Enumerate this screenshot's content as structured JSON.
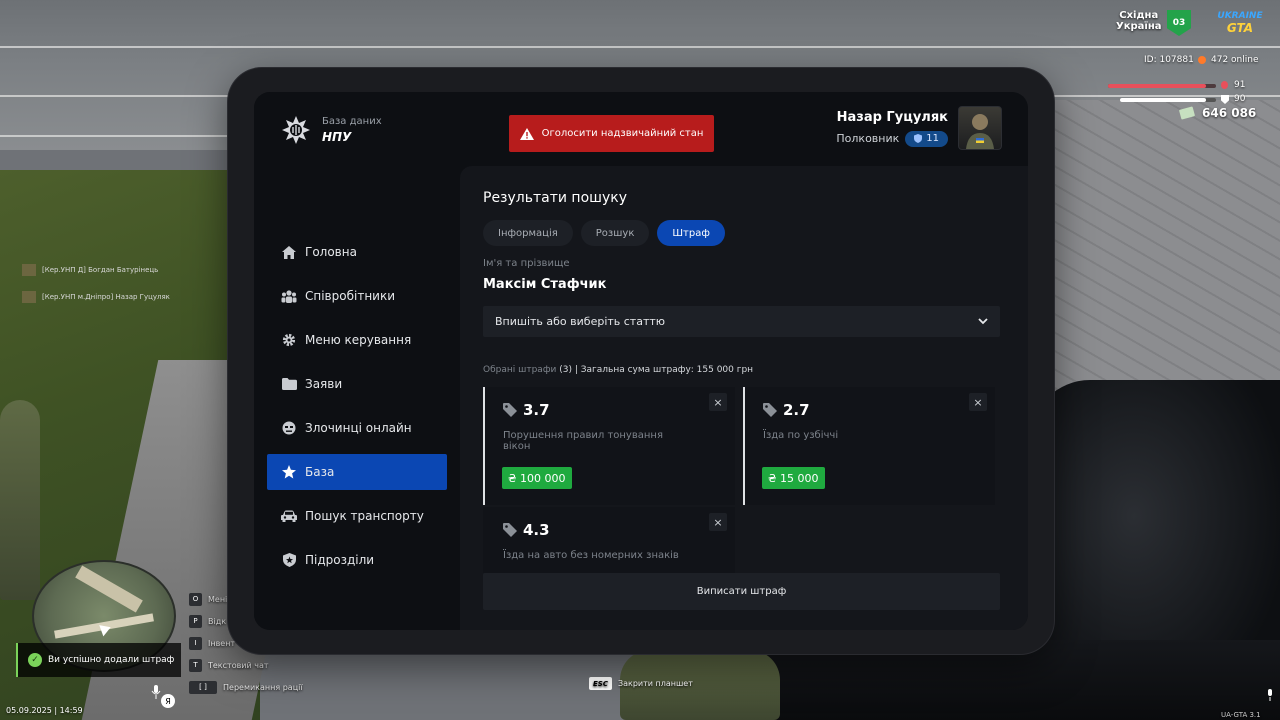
{
  "app": {
    "logo_sub": "База даних",
    "logo_main": "НПУ",
    "emergency_label": "Оголосити надзвичайний стан"
  },
  "user": {
    "name": "Назар Гуцуляк",
    "rank": "Полковник",
    "rank_level": "11"
  },
  "sidebar": {
    "items": [
      {
        "label": "Головна",
        "icon": "home-icon"
      },
      {
        "label": "Співробітники",
        "icon": "users-icon"
      },
      {
        "label": "Меню керування",
        "icon": "gear-icon"
      },
      {
        "label": "Заяви",
        "icon": "folder-icon"
      },
      {
        "label": "Злочинці онлайн",
        "icon": "criminal-icon"
      },
      {
        "label": "База",
        "icon": "star-icon",
        "active": true
      },
      {
        "label": "Пошук транспорту",
        "icon": "car-icon"
      },
      {
        "label": "Підрозділи",
        "icon": "shield-icon"
      }
    ]
  },
  "main": {
    "title": "Результати пошуку",
    "tabs": [
      {
        "label": "Інформація",
        "active": false
      },
      {
        "label": "Розшук",
        "active": false
      },
      {
        "label": "Штраф",
        "active": true
      }
    ],
    "name_label": "Ім'я та прізвище",
    "name_value": "Максім Стафчик",
    "select_placeholder": "Впишіть або виберіть статтю",
    "summary_muted": "Обрані штрафи",
    "summary_count": "(3)",
    "summary_rest": "| Загальна сума штрафу: 155 000 грн",
    "fines": [
      {
        "code": "3.7",
        "desc": "Порушення правил тонування вікон",
        "amount": "₴ 100 000"
      },
      {
        "code": "2.7",
        "desc": "Їзда по узбіччі",
        "amount": "₴ 15 000"
      },
      {
        "code": "4.3",
        "desc": "Їзда на авто без номерних знаків",
        "amount": ""
      }
    ],
    "issue_label": "Виписати штраф",
    "close_symbol": "×"
  },
  "hud": {
    "server_name_1": "Східна",
    "server_name_2": "Україна",
    "server_num": "03",
    "brand_1": "UKRAINE",
    "brand_2": "GTA",
    "player_id": "ID: 107881",
    "online": "472 online",
    "health": "91",
    "health_fraction": 0.91,
    "armor": "90",
    "armor_fraction": 0.9,
    "money": "646 086",
    "feed": [
      "[Кер.УНП Д] Богдан Батурінець",
      "[Кер.УНП м.Дніпро] Назар Гуцуляк"
    ],
    "keys": [
      {
        "key": "O",
        "label": "Мені"
      },
      {
        "key": "P",
        "label": "Відк"
      },
      {
        "key": "I",
        "label": "Інвент"
      },
      {
        "key": "T",
        "label": "Текстовий чат"
      },
      {
        "key": "[ ]",
        "label": "Перемикання рації"
      }
    ],
    "toast": "Ви успішно додали штраф",
    "esc_key": "ESC",
    "esc_label": "Закрити планшет",
    "datetime": "05.09.2025 | 14:59",
    "version": "UA-GTA 3.1",
    "mic_key": "Я"
  },
  "colors": {
    "accent": "#0b47b3",
    "danger": "#b71c1c",
    "success": "#1faa3f",
    "panel": "#14161b"
  }
}
